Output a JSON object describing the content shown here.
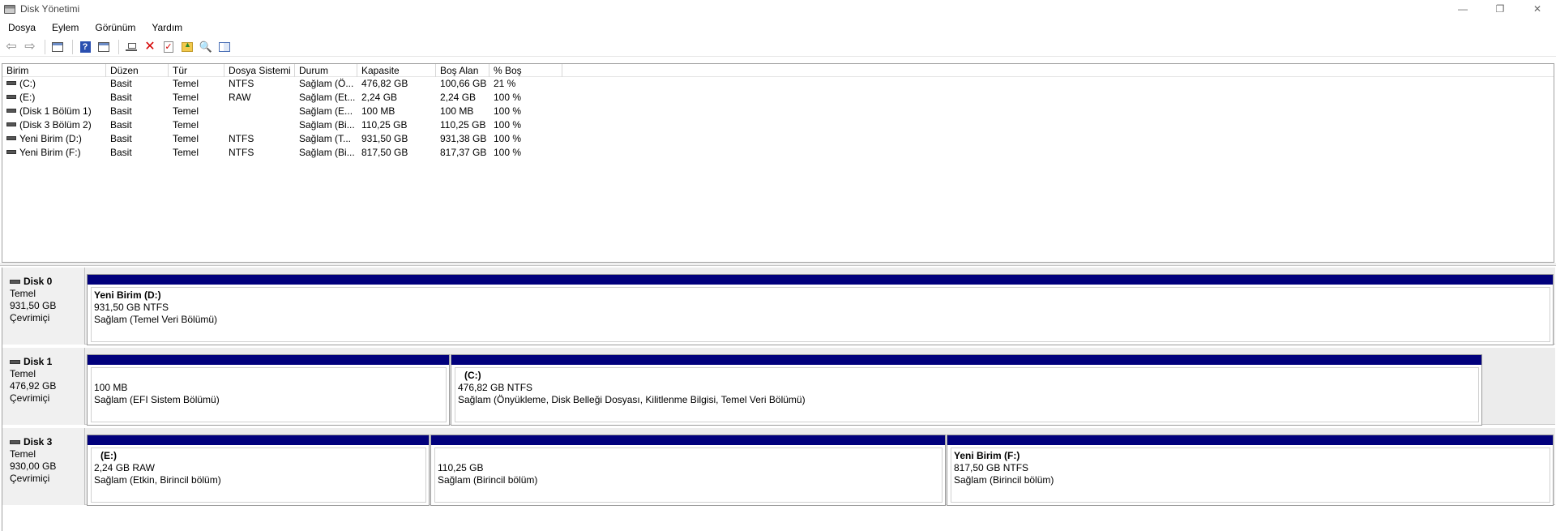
{
  "window": {
    "title": "Disk Yönetimi",
    "controls": {
      "minimize": "—",
      "restore": "❐",
      "close": "✕"
    }
  },
  "menu": [
    "Dosya",
    "Eylem",
    "Görünüm",
    "Yardım"
  ],
  "toolbar": {
    "icons": [
      "back-arrow-icon",
      "forward-arrow-icon",
      "console-tree-icon",
      "help-icon",
      "window-icon",
      "connect-icon",
      "delete-icon",
      "check-icon",
      "folder-up-icon",
      "search-folder-icon",
      "properties-icon"
    ]
  },
  "volume_list": {
    "columns": [
      "Birim",
      "Düzen",
      "Tür",
      "Dosya Sistemi",
      "Durum",
      "Kapasite",
      "Boş Alan",
      "% Boş"
    ],
    "rows": [
      {
        "birim": "(C:)",
        "duzen": "Basit",
        "tur": "Temel",
        "dosya": "NTFS",
        "durum": "Sağlam (Ö...",
        "kapasite": "476,82 GB",
        "bos": "100,66 GB",
        "yuzde": "21 %"
      },
      {
        "birim": "(E:)",
        "duzen": "Basit",
        "tur": "Temel",
        "dosya": "RAW",
        "durum": "Sağlam (Et...",
        "kapasite": "2,24 GB",
        "bos": "2,24 GB",
        "yuzde": "100 %"
      },
      {
        "birim": "(Disk 1 Bölüm 1)",
        "duzen": "Basit",
        "tur": "Temel",
        "dosya": "",
        "durum": "Sağlam (E...",
        "kapasite": "100 MB",
        "bos": "100 MB",
        "yuzde": "100 %"
      },
      {
        "birim": "(Disk 3 Bölüm 2)",
        "duzen": "Basit",
        "tur": "Temel",
        "dosya": "",
        "durum": "Sağlam (Bi...",
        "kapasite": "110,25 GB",
        "bos": "110,25 GB",
        "yuzde": "100 %"
      },
      {
        "birim": "Yeni Birim (D:)",
        "duzen": "Basit",
        "tur": "Temel",
        "dosya": "NTFS",
        "durum": "Sağlam (T...",
        "kapasite": "931,50 GB",
        "bos": "931,38 GB",
        "yuzde": "100 %"
      },
      {
        "birim": "Yeni Birim (F:)",
        "duzen": "Basit",
        "tur": "Temel",
        "dosya": "NTFS",
        "durum": "Sağlam (Bi...",
        "kapasite": "817,50 GB",
        "bos": "817,37 GB",
        "yuzde": "100 %"
      }
    ]
  },
  "disks": [
    {
      "name": "Disk 0",
      "type": "Temel",
      "size": "931,50 GB",
      "status": "Çevrimiçi",
      "partitions": [
        {
          "title": "Yeni Birim  (D:)",
          "size": "931,50 GB NTFS",
          "status": "Sağlam (Temel Veri Bölümü)"
        }
      ]
    },
    {
      "name": "Disk 1",
      "type": "Temel",
      "size": "476,92 GB",
      "status": "Çevrimiçi",
      "partitions": [
        {
          "title": "",
          "size": "100 MB",
          "status": "Sağlam (EFI Sistem Bölümü)"
        },
        {
          "title": "(C:)",
          "size": "476,82 GB NTFS",
          "status": "Sağlam (Önyükleme, Disk Belleği Dosyası, Kilitlenme Bilgisi, Temel Veri Bölümü)"
        }
      ]
    },
    {
      "name": "Disk 3",
      "type": "Temel",
      "size": "930,00 GB",
      "status": "Çevrimiçi",
      "partitions": [
        {
          "title": "(E:)",
          "size": "2,24 GB RAW",
          "status": "Sağlam (Etkin, Birincil bölüm)"
        },
        {
          "title": "",
          "size": "110,25 GB",
          "status": "Sağlam (Birincil bölüm)"
        },
        {
          "title": "Yeni Birim  (F:)",
          "size": "817,50 GB NTFS",
          "status": "Sağlam (Birincil bölüm)"
        }
      ]
    }
  ]
}
